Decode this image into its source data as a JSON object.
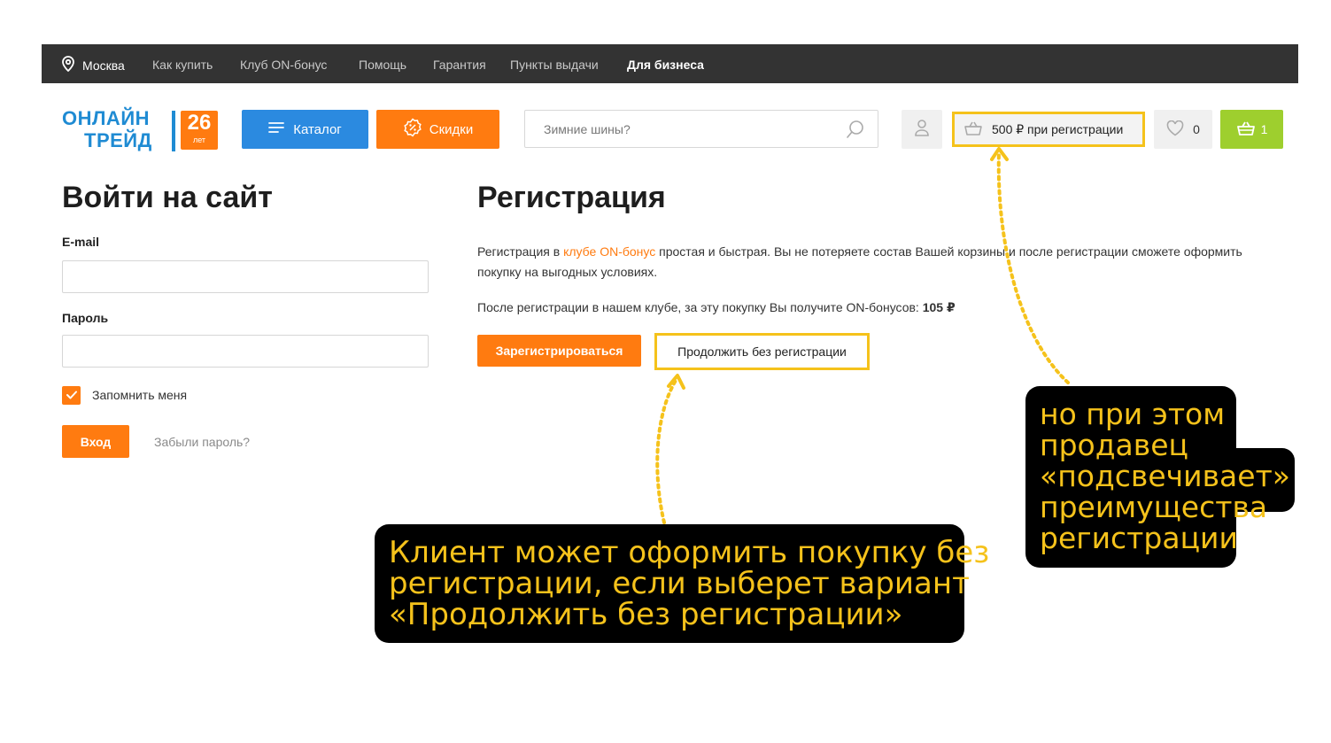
{
  "topbar": {
    "city": "Москва",
    "links": [
      "Как купить",
      "Клуб ON-бонус",
      "Помощь",
      "Гарантия",
      "Пункты выдачи"
    ],
    "business": "Для бизнеса"
  },
  "logo": {
    "line1": "ОНЛАЙН",
    "line2": "ТРЕЙД",
    "years_num": "26",
    "years_label": "лет"
  },
  "header": {
    "catalog": "Каталог",
    "sale": "Скидки",
    "search_placeholder": "Зимние шины?",
    "bonus_offer": "500 ₽ при регистрации",
    "favorites_count": "0",
    "cart_count": "1"
  },
  "login": {
    "title": "Войти на сайт",
    "email_label": "E-mail",
    "email_value": "",
    "password_label": "Пароль",
    "password_value": "",
    "remember_label": "Запомнить меня",
    "remember_checked": true,
    "submit": "Вход",
    "forgot": "Забыли пароль?"
  },
  "registration": {
    "title": "Регистрация",
    "text_before": "Регистрация в ",
    "text_link": "клубе ON-бонус",
    "text_after": " простая и быстрая. Вы не потеряете состав Вашей корзины и после регистрации сможете оформить покупку на выгодных условиях.",
    "bonus_text": "После регистрации в нашем клубе, за эту покупку Вы получите ON-бонусов: ",
    "bonus_value": "105 ₽",
    "register_button": "Зарегистрироваться",
    "guest_button": "Продолжить без регистрации"
  },
  "annotations": {
    "guest_note": [
      "Клиент может оформить покупку без",
      "регистрации, если выберет вариант",
      "«Продолжить без регистрации»"
    ],
    "bonus_note": [
      "но при этом",
      "продавец",
      "«подсвечивает»",
      "преимущества",
      "регистрации"
    ]
  },
  "colors": {
    "accent_orange": "#ff7b10",
    "accent_blue": "#2b8ae0",
    "highlight_yellow": "#f5c21b",
    "cart_green": "#9ecf2e",
    "topbar_dark": "#333333"
  }
}
